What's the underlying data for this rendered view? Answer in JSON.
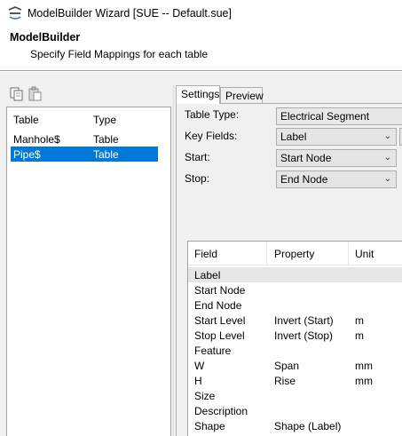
{
  "window": {
    "title": "ModelBuilder Wizard [SUE -- Default.sue]"
  },
  "header": {
    "title": "ModelBuilder",
    "subtitle": "Specify Field Mappings for each table"
  },
  "toolbar": {
    "copy_icon": "copy-icon",
    "paste_icon": "paste-icon"
  },
  "tables": {
    "columns": [
      "Table",
      "Type"
    ],
    "rows": [
      {
        "table": "Manhole$",
        "type": "Table",
        "selected": false
      },
      {
        "table": "Pipe$",
        "type": "Table",
        "selected": true
      }
    ]
  },
  "tabs": [
    "Settings",
    "Preview"
  ],
  "settings": {
    "table_type_label": "Table Type:",
    "table_type_value": "Electrical Segment",
    "key_fields_label": "Key Fields:",
    "key_fields_value": "Label",
    "start_label": "Start:",
    "start_value": "Start Node",
    "stop_label": "Stop:",
    "stop_value": "End Node"
  },
  "mapping": {
    "columns": [
      "Field",
      "Property",
      "Unit"
    ],
    "rows": [
      {
        "field": "Label",
        "property": "",
        "unit": ""
      },
      {
        "field": "Start Node",
        "property": "",
        "unit": ""
      },
      {
        "field": "End Node",
        "property": "",
        "unit": ""
      },
      {
        "field": "Start Level",
        "property": "Invert (Start)",
        "unit": "m"
      },
      {
        "field": "Stop Level",
        "property": "Invert (Stop)",
        "unit": "m"
      },
      {
        "field": "Feature",
        "property": "",
        "unit": ""
      },
      {
        "field": "W",
        "property": "Span",
        "unit": "mm"
      },
      {
        "field": "H",
        "property": "Rise",
        "unit": "mm"
      },
      {
        "field": "Size",
        "property": "",
        "unit": ""
      },
      {
        "field": "Description",
        "property": "",
        "unit": ""
      },
      {
        "field": "Shape",
        "property": "Shape (Label)",
        "unit": ""
      }
    ]
  },
  "colors": {
    "selection": "#0078d7",
    "row_highlight": "#e6e6e6",
    "panel_bg": "#f0f0f0"
  }
}
